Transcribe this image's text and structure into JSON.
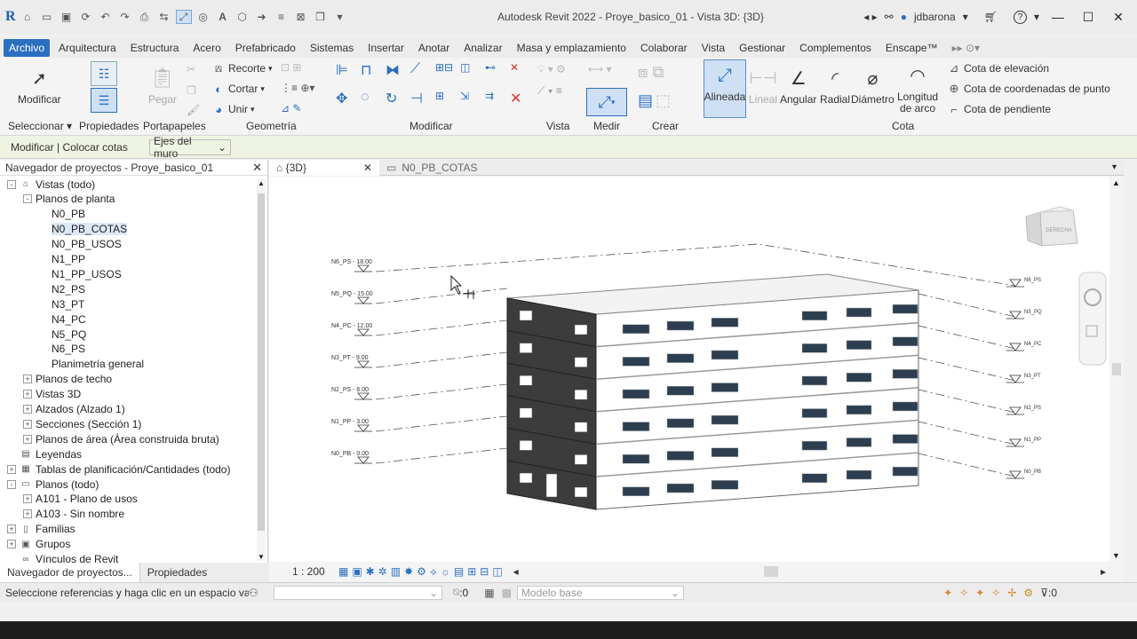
{
  "window": {
    "title": "Autodesk Revit 2022 - Proye_basico_01 - Vista 3D: {3D}",
    "user": "jdbarona"
  },
  "menu": [
    "Archivo",
    "Arquitectura",
    "Estructura",
    "Acero",
    "Prefabricado",
    "Sistemas",
    "Insertar",
    "Anotar",
    "Analizar",
    "Masa y emplazamiento",
    "Colaborar",
    "Vista",
    "Gestionar",
    "Complementos",
    "Enscape™"
  ],
  "ribbon": {
    "modificar": "Modificar",
    "pegar": "Pegar",
    "recorte": "Recorte",
    "cortar": "Cortar",
    "unir": "Unir",
    "panels": {
      "seleccionar": "Seleccionar",
      "propiedades": "Propiedades",
      "portapapeles": "Portapapeles",
      "geometria": "Geometría",
      "modificar": "Modificar",
      "vista": "Vista",
      "medir": "Medir",
      "crear": "Crear",
      "cota": "Cota"
    },
    "cota_tools": {
      "alineada": "Alineada",
      "lineal": "Lineal",
      "angular": "Angular",
      "radial": "Radial",
      "diametro": "Diámetro",
      "longitud1": "Longitud",
      "longitud2": "de arco"
    },
    "cota_side": [
      "Cota de elevación",
      "Cota de coordenadas de punto",
      "Cota de pendiente"
    ]
  },
  "options": {
    "context": "Modificar | Colocar cotas",
    "select": "Ejes del muro"
  },
  "browser": {
    "title": "Navegador de proyectos - Proye_basico_01",
    "items": [
      {
        "label": "Vistas (todo)",
        "level": 0,
        "tog": "-",
        "icon": "views"
      },
      {
        "label": "Planos de planta",
        "level": 1,
        "tog": "-"
      },
      {
        "label": "N0_PB",
        "level": 2
      },
      {
        "label": "N0_PB_COTAS",
        "level": 2,
        "selected": true
      },
      {
        "label": "N0_PB_USOS",
        "level": 2
      },
      {
        "label": "N1_PP",
        "level": 2
      },
      {
        "label": "N1_PP_USOS",
        "level": 2
      },
      {
        "label": "N2_PS",
        "level": 2
      },
      {
        "label": "N3_PT",
        "level": 2
      },
      {
        "label": "N4_PC",
        "level": 2
      },
      {
        "label": "N5_PQ",
        "level": 2
      },
      {
        "label": "N6_PS",
        "level": 2
      },
      {
        "label": "Planimetría general",
        "level": 2
      },
      {
        "label": "Planos de techo",
        "level": 1,
        "tog": "+"
      },
      {
        "label": "Vistas 3D",
        "level": 1,
        "tog": "+"
      },
      {
        "label": "Alzados (Alzado 1)",
        "level": 1,
        "tog": "+"
      },
      {
        "label": "Secciones (Sección 1)",
        "level": 1,
        "tog": "+"
      },
      {
        "label": "Planos de área (Área construida bruta)",
        "level": 1,
        "tog": "+"
      },
      {
        "label": "Leyendas",
        "level": 0,
        "icon": "legend"
      },
      {
        "label": "Tablas de planificación/Cantidades (todo)",
        "level": 0,
        "tog": "+",
        "icon": "table"
      },
      {
        "label": "Planos (todo)",
        "level": 0,
        "tog": "-",
        "icon": "sheet"
      },
      {
        "label": "A101 - Plano de usos",
        "level": 1,
        "tog": "+"
      },
      {
        "label": "A103 - Sin nombre",
        "level": 1,
        "tog": "+"
      },
      {
        "label": "Familias",
        "level": 0,
        "tog": "+",
        "icon": "family"
      },
      {
        "label": "Grupos",
        "level": 0,
        "tog": "+",
        "icon": "group"
      },
      {
        "label": "Vínculos de Revit",
        "level": 0,
        "icon": "link"
      }
    ],
    "tabs": [
      "Navegador de proyectos...",
      "Propiedades"
    ]
  },
  "viewtabs": [
    {
      "label": "{3D}",
      "active": true
    },
    {
      "label": "N0_PB_COTAS",
      "active": false
    }
  ],
  "levels_left": [
    "N6_PS - 18.00",
    "N5_PQ - 15.00",
    "N4_PC - 12.00",
    "N3_PT - 9.00",
    "N2_PS - 6.00",
    "N1_PP - 3.00",
    "N0_PB - 0.00"
  ],
  "levels_right": [
    "N6_PS",
    "N5_PQ",
    "N4_PC",
    "N3_PT",
    "N2_PS",
    "N1_PP",
    "N0_PB"
  ],
  "viewcube": "DERECHA",
  "scale": "1 : 200",
  "status": {
    "message": "Seleccione referencias y haga clic en un espacio vacío p",
    "workset_value": ":0",
    "model": "Modelo base",
    "filter_count": ":0"
  }
}
